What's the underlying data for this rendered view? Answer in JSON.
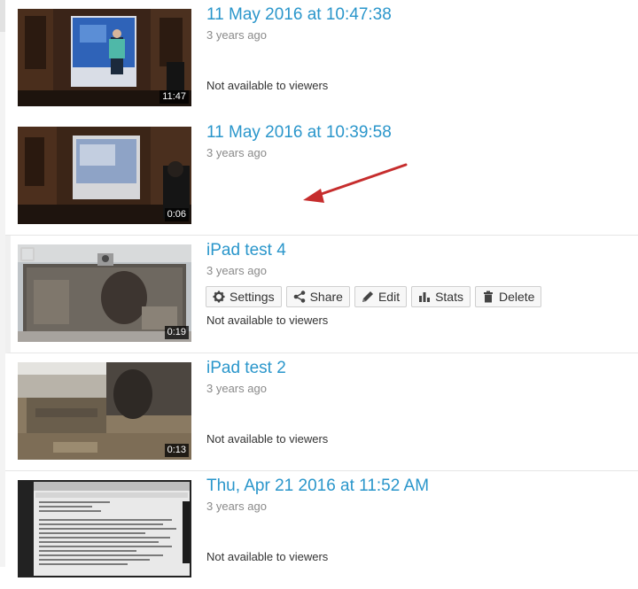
{
  "videos": [
    {
      "title": "11 May 2016 at 10:47:38",
      "age": "3 years ago",
      "duration": "11:47",
      "status": "Not available to viewers"
    },
    {
      "title": "11 May 2016 at 10:39:58",
      "age": "3 years ago",
      "duration": "0:06",
      "status": ""
    },
    {
      "title": "iPad test 4",
      "age": "3 years ago",
      "duration": "0:19",
      "status": "Not available to viewers",
      "actions": [
        {
          "label": "Settings",
          "icon": "gear-icon"
        },
        {
          "label": "Share",
          "icon": "share-icon"
        },
        {
          "label": "Edit",
          "icon": "pencil-icon"
        },
        {
          "label": "Stats",
          "icon": "bar-chart-icon"
        },
        {
          "label": "Delete",
          "icon": "trash-icon"
        }
      ]
    },
    {
      "title": "iPad test 2",
      "age": "3 years ago",
      "duration": "0:13",
      "status": "Not available to viewers"
    },
    {
      "title": "Thu, Apr 21 2016 at 11:52 AM",
      "age": "3 years ago",
      "duration": "",
      "status": "Not available to viewers"
    }
  ],
  "colors": {
    "title": "#2a96cb",
    "arrow": "#c62d2d"
  }
}
